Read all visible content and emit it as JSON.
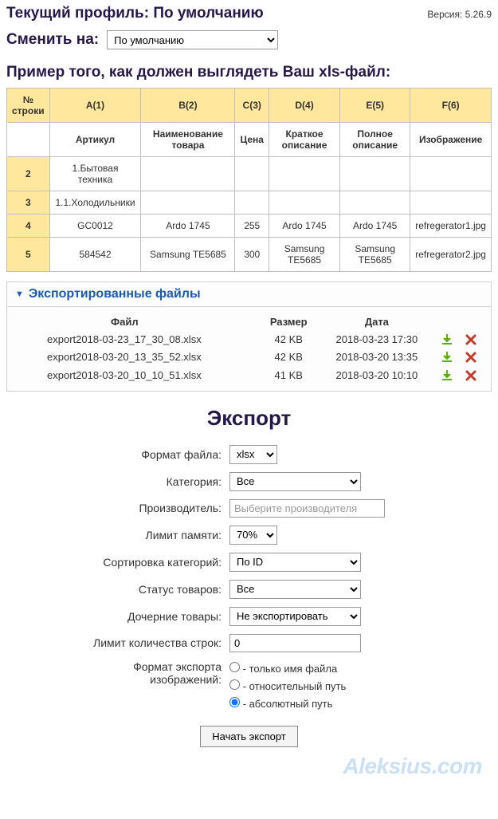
{
  "header": {
    "current_profile_label": "Текущий профиль:",
    "current_profile_value": "По умолчанию",
    "version_label": "Версия:",
    "version_value": "5.26.9",
    "switch_label": "Сменить на:",
    "switch_value": "По умолчанию"
  },
  "example": {
    "title": "Пример того, как должен выглядеть Ваш xls-файл:",
    "cols_header": "№ строки",
    "cols": [
      "A(1)",
      "B(2)",
      "C(3)",
      "D(4)",
      "E(5)",
      "F(6)"
    ],
    "subheaders": [
      "Артикул",
      "Наименование товара",
      "Цена",
      "Краткое описание",
      "Полное описание",
      "Изображение"
    ],
    "rows": [
      {
        "n": "2",
        "cells": [
          "1.Бытовая техника",
          "",
          "",
          "",
          "",
          ""
        ]
      },
      {
        "n": "3",
        "cells": [
          "1.1.Холодильники",
          "",
          "",
          "",
          "",
          ""
        ]
      },
      {
        "n": "4",
        "cells": [
          "GC0012",
          "Ardo 1745",
          "255",
          "Ardo 1745",
          "Ardo 1745",
          "refregerator1.jpg"
        ]
      },
      {
        "n": "5",
        "cells": [
          "584542",
          "Samsung TE5685",
          "300",
          "Samsung TE5685",
          "Samsung TE5685",
          "refregerator2.jpg"
        ]
      }
    ]
  },
  "exported": {
    "title": "Экспортированные файлы",
    "col_file": "Файл",
    "col_size": "Размер",
    "col_date": "Дата",
    "files": [
      {
        "name": "export2018-03-23_17_30_08.xlsx",
        "size": "42 KB",
        "date": "2018-03-23 17:30"
      },
      {
        "name": "export2018-03-20_13_35_52.xlsx",
        "size": "42 KB",
        "date": "2018-03-20 13:35"
      },
      {
        "name": "export2018-03-20_10_10_51.xlsx",
        "size": "41 KB",
        "date": "2018-03-20 10:10"
      }
    ]
  },
  "export_form": {
    "title": "Экспорт",
    "format_label": "Формат файла:",
    "format_value": "xlsx",
    "category_label": "Категория:",
    "category_value": "Все",
    "manufacturer_label": "Производитель:",
    "manufacturer_placeholder": "Выберите производителя",
    "memory_label": "Лимит памяти:",
    "memory_value": "70%",
    "sort_label": "Сортировка категорий:",
    "sort_value": "По ID",
    "status_label": "Статус товаров:",
    "status_value": "Все",
    "children_label": "Дочерние товары:",
    "children_value": "Не экспортировать",
    "rowlimit_label": "Лимит количества строк:",
    "rowlimit_value": "0",
    "img_format_label1": "Формат экспорта",
    "img_format_label2": "изображений:",
    "img_opt1": "- только имя файла",
    "img_opt2": "- относительный путь",
    "img_opt3": "- абсолютный путь",
    "submit": "Начать экспорт"
  },
  "watermark": "Aleksius.com"
}
